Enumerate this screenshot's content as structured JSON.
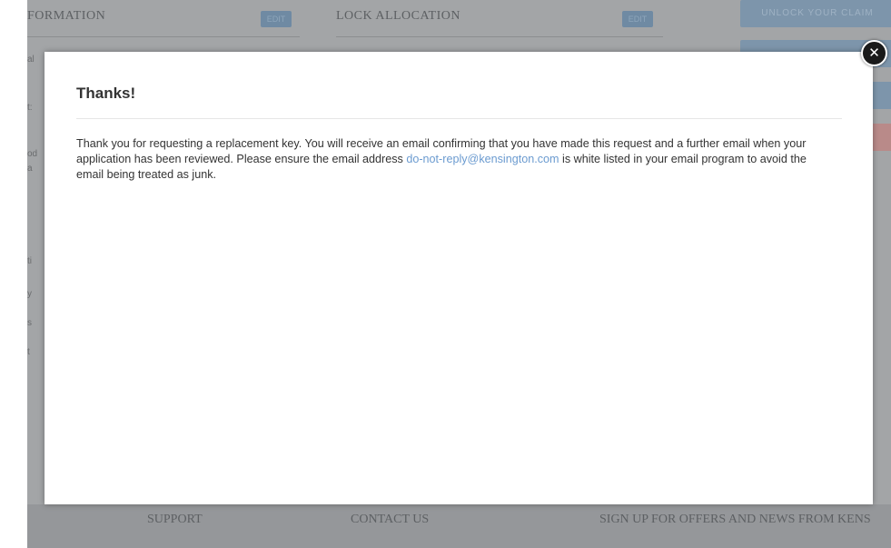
{
  "background": {
    "headings": [
      "FORMATION",
      "LOCK ALLOCATION"
    ],
    "edit_label": "EDIT",
    "side_button_label": "UNLOCK YOUR CLAIM",
    "left_fragments": [
      "al",
      "t:",
      "od",
      "a",
      "ti",
      "y",
      "s",
      "t"
    ],
    "footer_links": [
      "SUPPORT",
      "CONTACT US",
      "SIGN UP FOR OFFERS AND NEWS FROM KENS"
    ]
  },
  "modal": {
    "title": "Thanks!",
    "body_before": "Thank you for requesting a replacement key. You will receive an email confirming that you have made this request and a further email when your application has been reviewed. Please ensure the email address ",
    "email_link": "do-not-reply@kensington.com",
    "body_after": " is white listed in your email program to avoid the email being treated as junk.",
    "close_symbol": "✕"
  },
  "colors": {
    "overlay": "#a3a5a7",
    "modal": "#ffffff",
    "link": "#6b9bd0",
    "close_button": "#1a1a1a"
  }
}
